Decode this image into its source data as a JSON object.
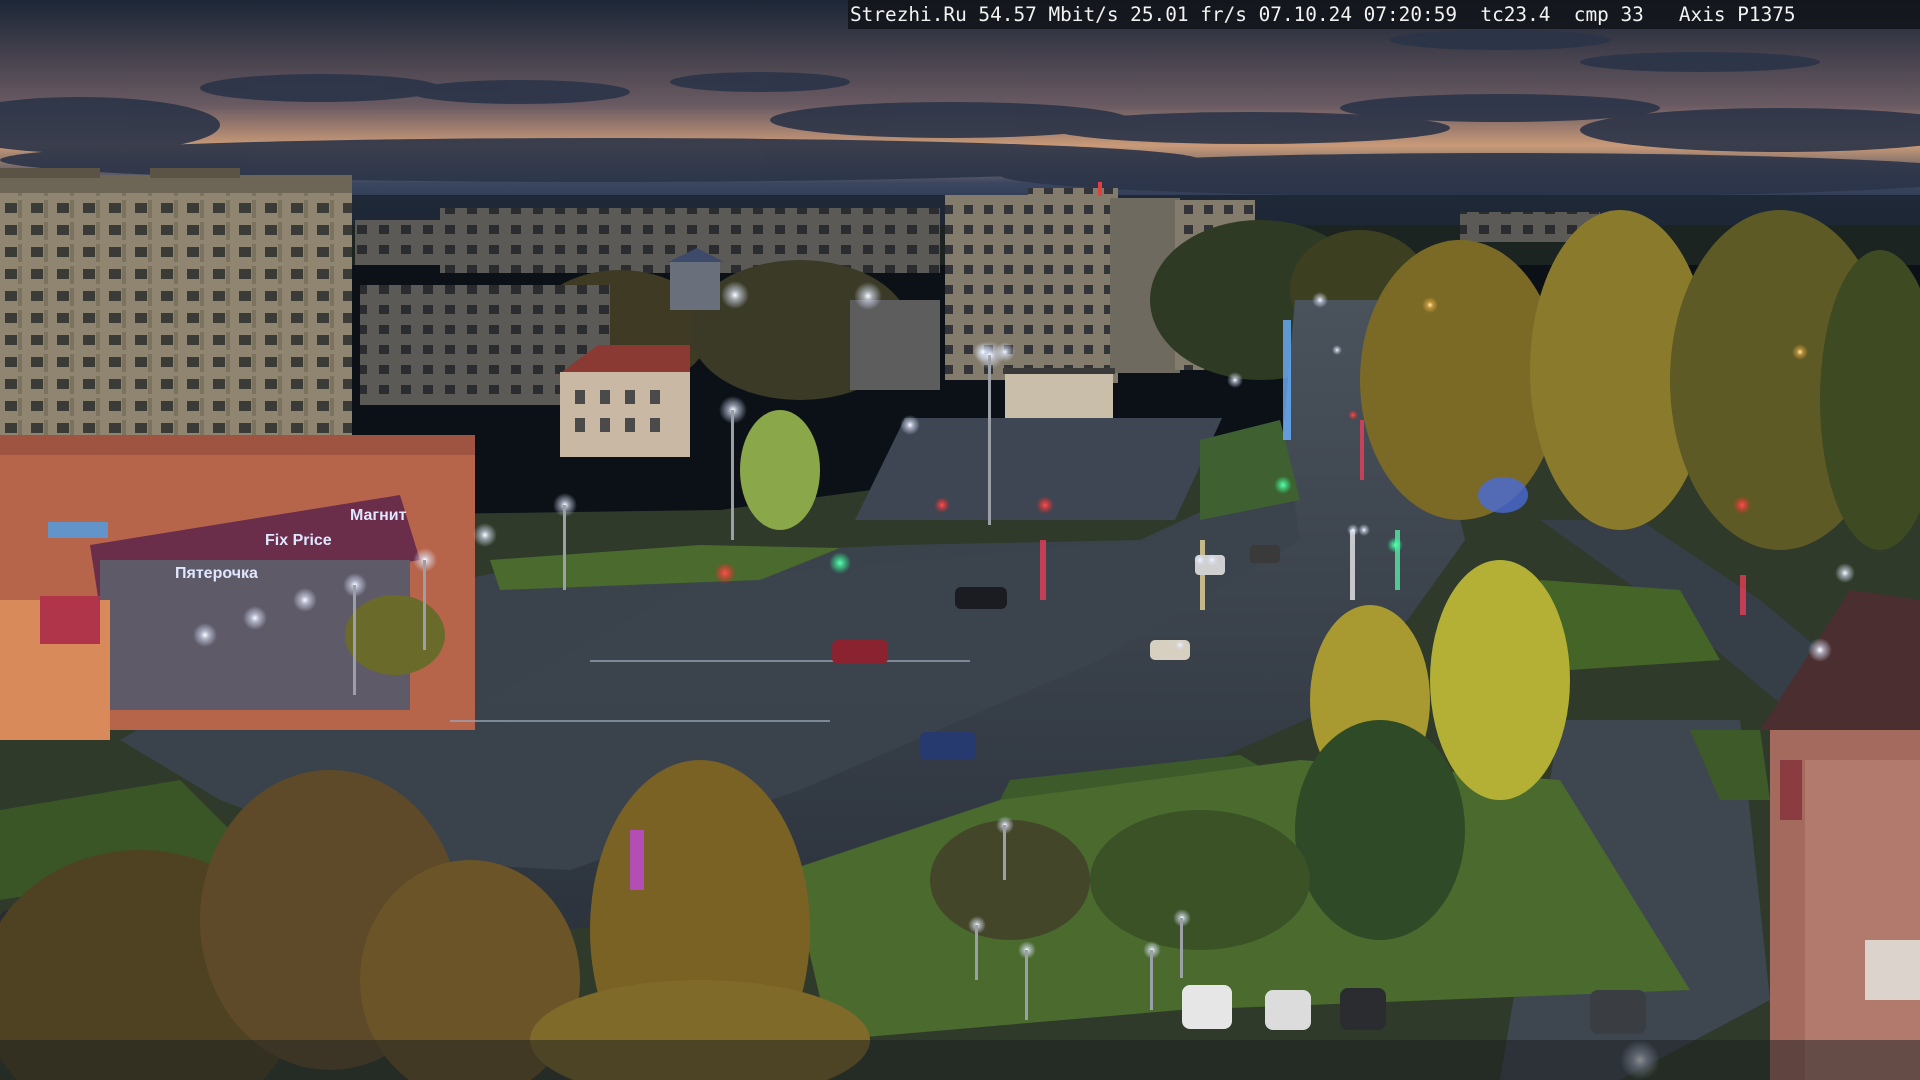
{
  "camera_overlay": {
    "text": "Strezhi.Ru 54.57 Mbit/s 25.01 fr/s 07.10.24 07:20:59  tc23.4  cmp 33   Axis P1375"
  },
  "storefront_signs": [
    "Пятерочка",
    "Fix Price",
    "Магнит"
  ],
  "colors": {
    "sky_top": "#1c2636",
    "sky_glow": "#c99a78",
    "road": "#39424d",
    "grass": "#4a6a2e",
    "foliage": "#8a7a2c",
    "building": "#8f8571",
    "facade_red": "#a8503e",
    "lamp": "#ffffff"
  }
}
